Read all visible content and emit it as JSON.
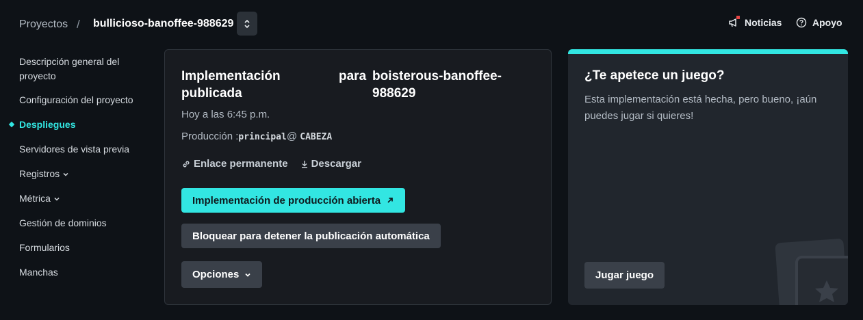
{
  "breadcrumb": {
    "projects": "Proyectos",
    "separator": "/",
    "site": "bullicioso-banoffee-988629"
  },
  "header": {
    "news": "Noticias",
    "help": "Apoyo"
  },
  "sidebar": {
    "items": [
      {
        "label": "Descripción general del proyecto"
      },
      {
        "label": "Configuración del proyecto"
      },
      {
        "label": "Despliegues",
        "active": true
      },
      {
        "label": "Servidores de vista previa"
      },
      {
        "label": "Registros",
        "caret": true
      },
      {
        "label": "Métrica",
        "caret": true
      },
      {
        "label": "Gestión de dominios"
      },
      {
        "label": "Formularios"
      },
      {
        "label": "Manchas"
      }
    ]
  },
  "deploy": {
    "title_left": "Implementación publicada",
    "title_para": "para",
    "title_site": "boisterous-banoffee-988629",
    "time": "Hoy a las 6:45 p.m.",
    "branch_prefix": "Producción :",
    "branch_name": "principal",
    "branch_at": "@",
    "branch_ref": "CABEZA",
    "permalink": "Enlace permanente",
    "download": "Descargar",
    "open_button": "Implementación de producción abierta",
    "lock_button": "Bloquear para detener la publicación automática",
    "options_button": "Opciones"
  },
  "game": {
    "title": "¿Te apetece un juego?",
    "text": "Esta implementación está hecha, pero bueno, ¡aún puedes jugar si quieres!",
    "button": "Jugar juego"
  },
  "colors": {
    "accent": "#32e6e2",
    "background": "#0e1217",
    "card": "#181b20",
    "game_card": "#21262d",
    "button": "#3a4049"
  }
}
